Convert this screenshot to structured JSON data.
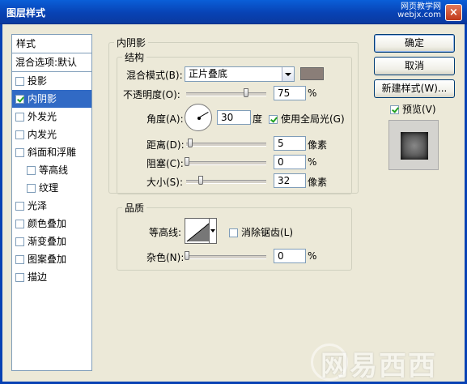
{
  "window": {
    "title": "图层样式",
    "watermark_top": "网页教学网\nwebjx.com",
    "close_label": "×"
  },
  "sidebar": {
    "header": "样式",
    "blend_options": "混合选项:默认",
    "items": [
      {
        "label": "投影",
        "checked": false,
        "active": false,
        "sub": false
      },
      {
        "label": "内阴影",
        "checked": true,
        "active": true,
        "sub": false
      },
      {
        "label": "外发光",
        "checked": false,
        "active": false,
        "sub": false
      },
      {
        "label": "内发光",
        "checked": false,
        "active": false,
        "sub": false
      },
      {
        "label": "斜面和浮雕",
        "checked": false,
        "active": false,
        "sub": false
      },
      {
        "label": "等高线",
        "checked": false,
        "active": false,
        "sub": true
      },
      {
        "label": "纹理",
        "checked": false,
        "active": false,
        "sub": true
      },
      {
        "label": "光泽",
        "checked": false,
        "active": false,
        "sub": false
      },
      {
        "label": "颜色叠加",
        "checked": false,
        "active": false,
        "sub": false
      },
      {
        "label": "渐变叠加",
        "checked": false,
        "active": false,
        "sub": false
      },
      {
        "label": "图案叠加",
        "checked": false,
        "active": false,
        "sub": false
      },
      {
        "label": "描边",
        "checked": false,
        "active": false,
        "sub": false
      }
    ]
  },
  "inner_shadow": {
    "group_title": "内阴影",
    "structure": {
      "title": "结构",
      "blend_mode_label": "混合模式(B):",
      "blend_mode_value": "正片叠底",
      "blend_color": "#8a7e78",
      "opacity_label": "不透明度(O):",
      "opacity_value": "75",
      "opacity_unit": "%",
      "opacity_level": 0.75,
      "angle_label": "角度(A):",
      "angle_value": "30",
      "angle_unit": "度",
      "global_light_label": "使用全局光(G)",
      "global_light_checked": true,
      "distance_label": "距离(D):",
      "distance_value": "5",
      "distance_unit": "像素",
      "choke_label": "阻塞(C):",
      "choke_value": "0",
      "choke_unit": "%",
      "size_label": "大小(S):",
      "size_value": "32",
      "size_unit": "像素"
    },
    "quality": {
      "title": "品质",
      "contour_label": "等高线:",
      "antialias_label": "消除锯齿(L)",
      "antialias_checked": false,
      "noise_label": "杂色(N):",
      "noise_value": "0",
      "noise_unit": "%"
    }
  },
  "buttons": {
    "ok": "确定",
    "cancel": "取消",
    "new_style": "新建样式(W)...",
    "preview_label": "预览(V)",
    "preview_checked": true
  },
  "watermark": "网易西西"
}
